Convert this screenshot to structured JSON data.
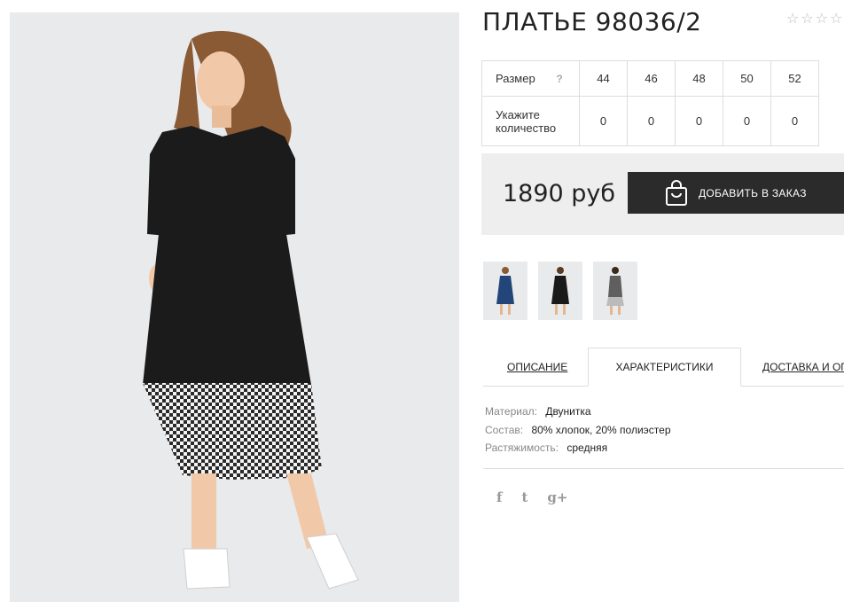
{
  "product": {
    "title": "ПЛАТЬЕ 98036/2",
    "rating_stars": [
      "☆",
      "☆",
      "☆",
      "☆"
    ]
  },
  "sizes": {
    "label": "Размер",
    "help": "?",
    "qty_label": "Укажите количество",
    "columns": [
      "44",
      "46",
      "48",
      "50",
      "52"
    ],
    "quantities": [
      "0",
      "0",
      "0",
      "0",
      "0"
    ]
  },
  "purchase": {
    "price": "1890 руб",
    "add_button": "ДОБАВИТЬ В ЗАКАЗ"
  },
  "tabs": {
    "description": "ОПИСАНИЕ",
    "characteristics": "ХАРАКТЕРИСТИКИ",
    "delivery": "ДОСТАВКА И ОПЛ"
  },
  "specs": [
    {
      "key": "Материал:",
      "value": "Двунитка"
    },
    {
      "key": "Состав:",
      "value": "80% хлопок, 20% полиэстер"
    },
    {
      "key": "Растяжимость:",
      "value": "средняя"
    }
  ],
  "social": {
    "facebook": "f",
    "twitter": "t",
    "googleplus": "g+"
  },
  "colors": {
    "dark_button": "#2b2b2b",
    "price_bg": "#eeeeee",
    "photo_bg": "#e9eaec"
  },
  "icons": {
    "bag": "shopping-bag-icon",
    "star": "star-outline-icon"
  }
}
